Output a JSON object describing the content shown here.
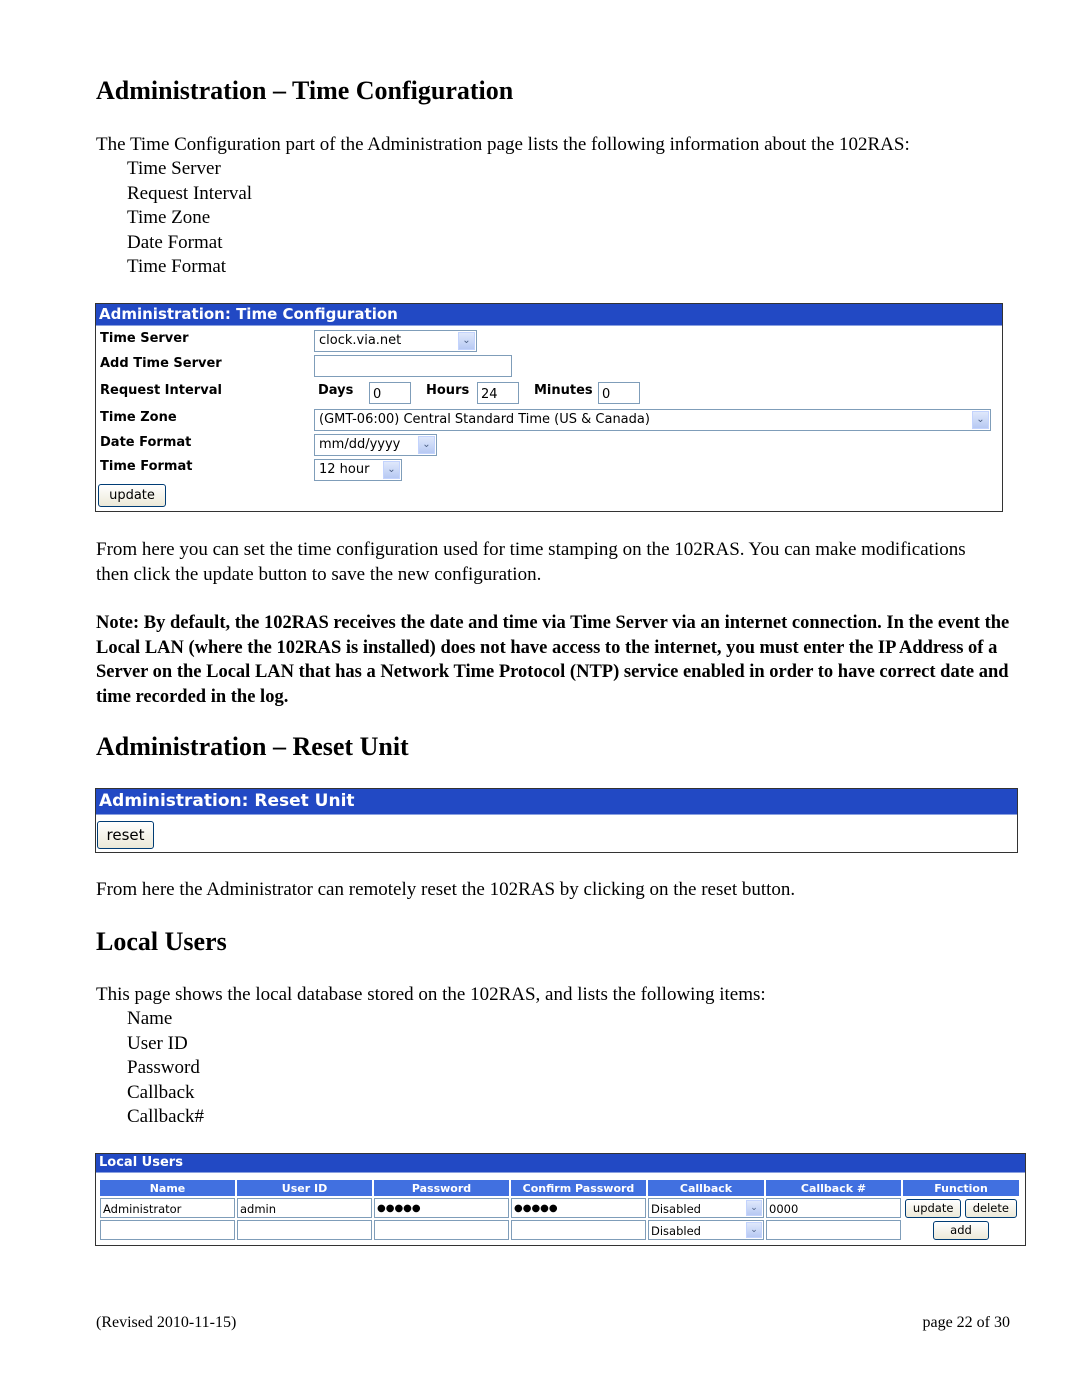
{
  "sections": {
    "time_config": {
      "heading": "Administration – Time Configuration",
      "intro": "The Time Configuration part of the Administration page lists the following information about the 102RAS:",
      "items": [
        "Time Server",
        "Request Interval",
        "Time Zone",
        "Date Format",
        "Time Format"
      ],
      "after_text": "From here you can set the time configuration used for time stamping on the 102RAS.  You can make modifications then click the update button to save the new configuration.",
      "note": "Note: By default, the 102RAS receives the date and time via Time Server via an internet connection. In the event the Local LAN (where the 102RAS is installed) does not have access to the internet, you must enter the IP Address of a Server on the Local LAN that has a Network Time Protocol (NTP) service enabled in order to have correct date and time recorded in the log."
    },
    "reset_unit": {
      "heading": "Administration – Reset Unit",
      "after_text": "From here the Administrator can remotely reset the 102RAS by clicking on the reset button."
    },
    "local_users": {
      "heading": "Local Users",
      "intro": "This page shows the local database stored on the 102RAS, and lists the following items:",
      "items": [
        "Name",
        "User ID",
        "Password",
        "Callback",
        "Callback#"
      ]
    }
  },
  "time_panel": {
    "title": "Administration: Time Configuration",
    "labels": {
      "time_server": "Time Server",
      "add_time_server": "Add Time Server",
      "request_interval": "Request Interval",
      "time_zone": "Time Zone",
      "date_format": "Date Format",
      "time_format": "Time Format",
      "days": "Days",
      "hours": "Hours",
      "minutes": "Minutes"
    },
    "values": {
      "time_server": "clock.via.net",
      "add_time_server": "",
      "days": "0",
      "hours": "24",
      "minutes": "0",
      "time_zone": "(GMT-06:00) Central Standard Time (US & Canada)",
      "date_format": "mm/dd/yyyy",
      "time_format": "12 hour"
    },
    "update_button": "update"
  },
  "reset_panel": {
    "title": "Administration: Reset Unit",
    "reset_button": "reset"
  },
  "users_panel": {
    "title": "Local Users",
    "columns": [
      "Name",
      "User ID",
      "Password",
      "Confirm Password",
      "Callback",
      "Callback #",
      "Function"
    ],
    "rows": [
      {
        "name": "Administrator",
        "user_id": "admin",
        "password": "●●●●●",
        "confirm": "●●●●●",
        "callback": "Disabled",
        "callback_no": "0000",
        "buttons": [
          "update",
          "delete"
        ]
      },
      {
        "name": "",
        "user_id": "",
        "password": "",
        "confirm": "",
        "callback": "Disabled",
        "callback_no": "",
        "buttons": [
          "add"
        ]
      }
    ]
  },
  "footer": {
    "revised": "(Revised 2010-11-15)",
    "page": "page 22 of 30"
  },
  "colors": {
    "panel_header": "#2249c4",
    "table_header": "#4170e0",
    "input_border": "#7f9db9"
  }
}
